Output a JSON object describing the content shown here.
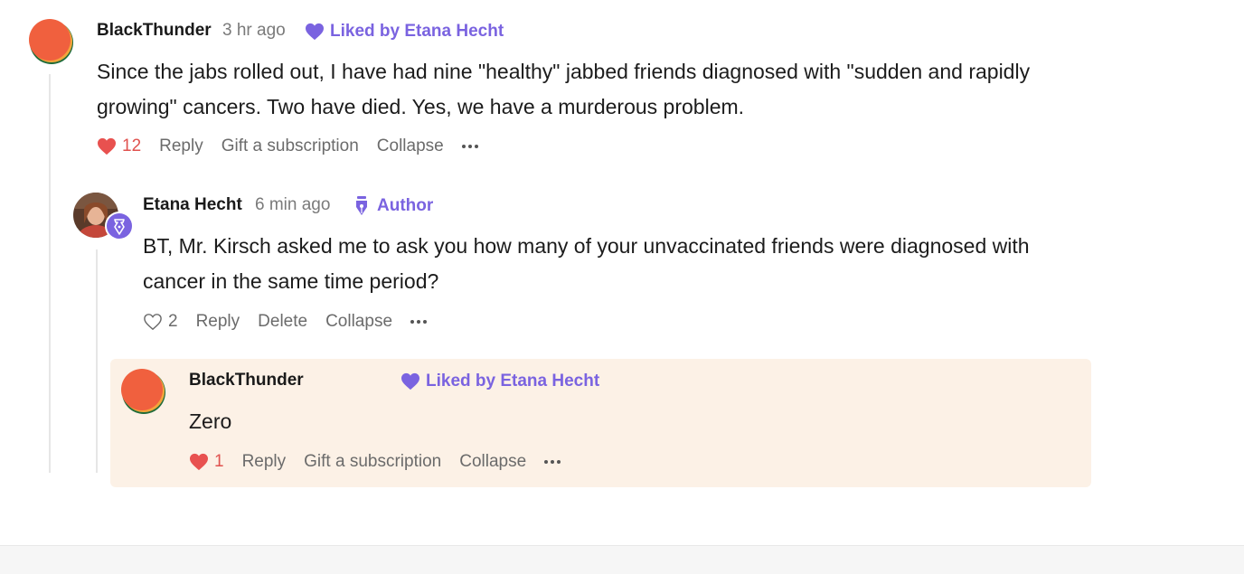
{
  "comments": [
    {
      "author": "BlackThunder",
      "time": "3 hr ago",
      "liked_by": "Liked by Etana Hecht",
      "text": "Since the jabs rolled out, I have had nine \"healthy\" jabbed friends diagnosed with \"sudden and rapidly growing\" cancers. Two have died. Yes, we have a murderous problem.",
      "likes": "12",
      "actions": {
        "reply": "Reply",
        "gift": "Gift a subscription",
        "collapse": "Collapse"
      },
      "liked": true,
      "heart_color": "#e8514f",
      "reply": {
        "author": "Etana Hecht",
        "time": "6 min ago",
        "badge": "Author",
        "text": "BT, Mr. Kirsch asked me to ask you how many of your unvaccinated friends were diagnosed with cancer in the same time period?",
        "likes": "2",
        "actions": {
          "reply": "Reply",
          "delete": "Delete",
          "collapse": "Collapse"
        },
        "liked": false,
        "reply": {
          "author": "BlackThunder",
          "liked_by": "Liked by Etana Hecht",
          "text": "Zero",
          "likes": "1",
          "actions": {
            "reply": "Reply",
            "gift": "Gift a subscription",
            "collapse": "Collapse"
          },
          "liked": true,
          "highlight_color": "#fcf1e6"
        }
      }
    }
  ],
  "colors": {
    "accent": "#7a63e0",
    "like_red": "#e8514f",
    "muted_text": "#6b6b6b"
  },
  "icons": {
    "liked_badge": "heart-icon",
    "author_badge": "fountain-pen-icon",
    "more": "ellipsis-icon"
  }
}
